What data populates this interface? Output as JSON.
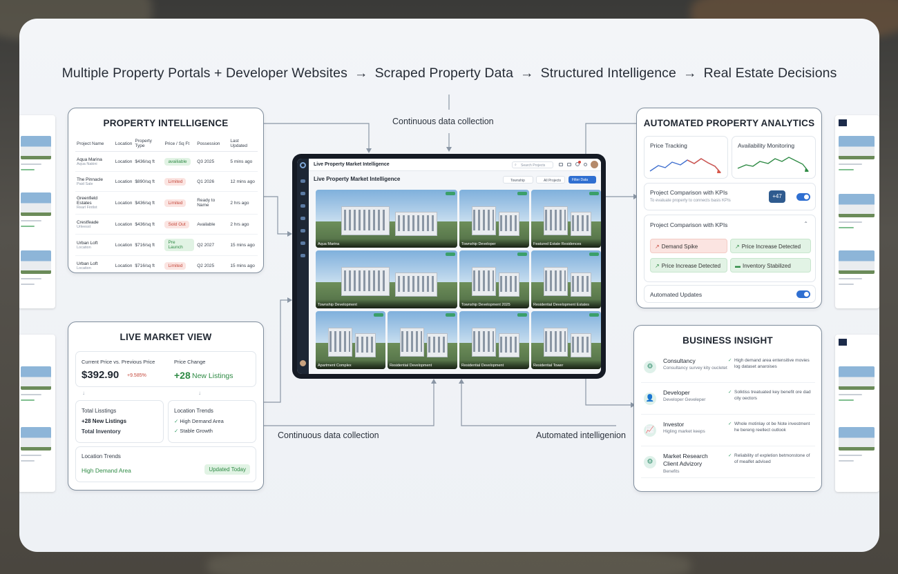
{
  "headline": {
    "step1": "Multiple Property Portals + Developer Websites",
    "step2": "Scraped Property Data",
    "step3": "Structured Intelligence",
    "step4": "Real Estate Decisions",
    "arrow": "→"
  },
  "flow_labels": {
    "top": "Continuous data collection",
    "bottom_left": "Continuous data collection",
    "bottom_right": "Automated intelligenion"
  },
  "property_intelligence": {
    "title": "PROPERTY INTELLIGENCE",
    "columns": [
      "Project Name",
      "Location",
      "Property Type",
      "Price / Sq Ft",
      "Possession",
      "Last Updated"
    ],
    "rows": [
      {
        "name": "Aqua Marina",
        "sub": "Aqua Nakini",
        "location": "Location",
        "price": "$436/sq ft",
        "status": "availiable",
        "status_color": "g",
        "possession": "Q3 2025",
        "updated": "5 mins ago"
      },
      {
        "name": "The Pinnacle",
        "sub": "Paid Sale",
        "location": "Location",
        "price": "$890/sq ft",
        "status": "Limited",
        "status_color": "r",
        "possession": "Q1 2026",
        "updated": "12 mins ago"
      },
      {
        "name": "Greenfield Estates",
        "sub": "Rearl Fintlot",
        "location": "Location",
        "price": "$436/sq ft",
        "status": "Limited",
        "status_color": "r",
        "possession": "Ready to Name",
        "updated": "2 hrs ago"
      },
      {
        "name": "Crestfeade",
        "sub": "Urleesst",
        "location": "Location",
        "price": "$436/sq ft",
        "status": "Sold Out",
        "status_color": "r",
        "possession": "Available",
        "updated": "2 hrs ago"
      },
      {
        "name": "Urban Loft",
        "sub": "Location",
        "location": "Location",
        "price": "$716/sq ft",
        "status": "Pre Launch",
        "status_color": "g",
        "possession": "Q2 2027",
        "updated": "15 mins ago"
      },
      {
        "name": "Urban Loft",
        "sub": "Location",
        "location": "Location",
        "price": "$716/sq ft",
        "status": "Limited",
        "status_color": "r",
        "possession": "Q2 2025",
        "updated": "15 mins ago"
      }
    ]
  },
  "live_market": {
    "title": "LIVE MARKET VIEW",
    "price_label": "Current Price vs. Previous Price",
    "price_value": "$392.90",
    "price_delta": "+9.585%",
    "change_label": "Price Change",
    "change_count": "+28",
    "change_text": "New Listings",
    "listings_label": "Total Lisstings",
    "listings_value": "+28 New Listings",
    "inventory_label": "Total Inventory",
    "trends_label": "Location Trends",
    "trend_1": "High Demand Area",
    "trend_2": "Stable Growth",
    "trends2_label": "Location Trends",
    "trends2_value": "High Demand Area",
    "updated": "Updated Today"
  },
  "dashboard": {
    "window_title": "Live Property Market Intelligence",
    "search_placeholder": "Search Projects",
    "heading": "Live Property Market Intelligence",
    "filter_1": "Township",
    "filter_2": "All Projects",
    "action": "Filter Data",
    "tiles": [
      {
        "cap": "Aqua Marina"
      },
      {
        "cap": "Township Developer"
      },
      {
        "cap": "Featured Estate Residences"
      },
      {
        "cap": "Township Development"
      },
      {
        "cap": "Township Development 2025"
      },
      {
        "cap": "Residential Development Estates"
      },
      {
        "cap": "Apartment Complex"
      },
      {
        "cap": "Residential Development"
      },
      {
        "cap": "Residential Development"
      },
      {
        "cap": "Residential Tower"
      }
    ]
  },
  "analytics": {
    "title": "AUTOMATED PROPERTY ANALYTICS",
    "price_tracking": "Price Tracking",
    "availability": "Availability Monitoring",
    "comparison_title": "Project Comparison with KPIs",
    "comparison_sub": "To evaluate property to connects basis KPIs",
    "kpi_badge": "+47",
    "comparison_title_2": "Project Comparison with KPIs",
    "chips": [
      {
        "label": "Demand Spike",
        "color": "r",
        "icon": "↗"
      },
      {
        "label": "Price Increase Detected",
        "color": "g",
        "icon": "↗"
      },
      {
        "label": "Price Increase Detected",
        "color": "g",
        "icon": "↗"
      },
      {
        "label": "Inventory Stabilized",
        "color": "g",
        "icon": "▬"
      }
    ],
    "auto_updates": "Automated Updates"
  },
  "business_insight": {
    "title": "BUSINESS INSIGHT",
    "rows": [
      {
        "name": "Consultancy",
        "desc": "Consultancy survey kity oucletet",
        "note": "High demand area entensitive movies log dataset anaroises",
        "icon": "⚙"
      },
      {
        "name": "Developer",
        "desc": "Developer Geveleper",
        "note": "Solktiss treatuated key benefit ore dad city oectors",
        "icon": "👤"
      },
      {
        "name": "Investor",
        "desc": "Higling market keeps",
        "note": "Whole motinlay ot be Note investment he bereng reellect outlook",
        "icon": "📈"
      },
      {
        "name": "Market Research\nClient Advizory",
        "desc": "Benefits",
        "note": "Reliability of expletion betmonstone of of mealfet advised",
        "icon": "⚙"
      }
    ]
  },
  "colors": {
    "accent": "#2f6fd1",
    "positive": "#2e8a44",
    "negative": "#c5483c",
    "border": "#7e8c9c"
  }
}
